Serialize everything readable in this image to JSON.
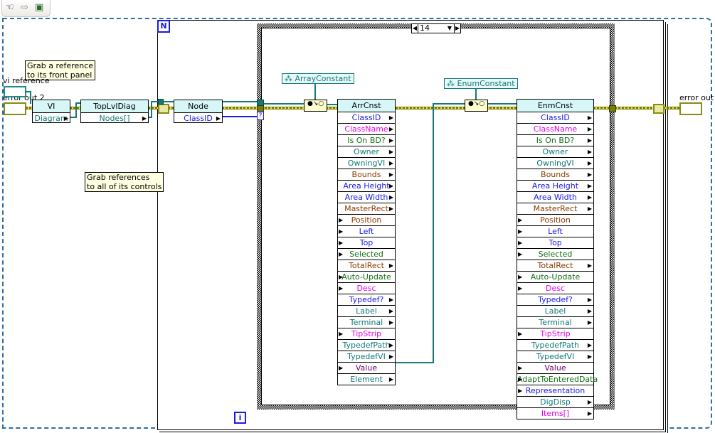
{
  "toolbar": {
    "icons": [
      "hand-operate-icon",
      "run-arrow-icon",
      "highlight-execution-icon"
    ],
    "hand_glyph": "☜",
    "arrow_glyph": "⇨",
    "highlight_glyph": "▣"
  },
  "labels": {
    "vi_reference": "vi reference",
    "error_out_2": "error out 2",
    "error_out": "error out"
  },
  "notes": {
    "front_panel": "Grab a reference\nto its front panel",
    "front_panel_l1": "Grab a reference",
    "front_panel_l2": "to its front panel",
    "controls_l1": "Grab references",
    "controls_l2": "to all of its controls"
  },
  "loop": {
    "count_terminal": "N",
    "iteration_terminal": "i"
  },
  "case": {
    "selector_value": "14",
    "left_arrow": "◀",
    "right_arrow": "▶",
    "dropdown": "▼"
  },
  "nodes": {
    "vi": {
      "title": "VI",
      "property": "Diagram"
    },
    "toplvldiag": {
      "title": "TopLvlDiag",
      "property": "Nodes[]"
    },
    "node": {
      "title": "Node",
      "property": "ClassID"
    },
    "class_id_terminal": "?",
    "arr_const": "ArrayConstant",
    "enum_const": "EnumConstant",
    "arrcnst": {
      "title": "ArrCnst",
      "properties": [
        {
          "label": "ClassID",
          "color": "blue",
          "dir": "out"
        },
        {
          "label": "ClassName",
          "color": "mag",
          "dir": "out"
        },
        {
          "label": "Is On BD?",
          "color": "green",
          "dir": "out"
        },
        {
          "label": "Owner",
          "color": "teal",
          "dir": "out"
        },
        {
          "label": "OwningVI",
          "color": "teal",
          "dir": "out"
        },
        {
          "label": "Bounds",
          "color": "brown",
          "dir": "out"
        },
        {
          "label": "Area Height",
          "color": "blue",
          "dir": "out"
        },
        {
          "label": "Area Width",
          "color": "blue",
          "dir": "out"
        },
        {
          "label": "MasterRect",
          "color": "brown",
          "dir": "out"
        },
        {
          "label": "Position",
          "color": "brown",
          "dir": "in"
        },
        {
          "label": "Left",
          "color": "blue",
          "dir": "in"
        },
        {
          "label": "Top",
          "color": "blue",
          "dir": "in"
        },
        {
          "label": "Selected",
          "color": "green",
          "dir": "in"
        },
        {
          "label": "TotalRect",
          "color": "brown",
          "dir": "out"
        },
        {
          "label": "Auto-Update",
          "color": "green",
          "dir": "in"
        },
        {
          "label": "Desc",
          "color": "mag",
          "dir": "in"
        },
        {
          "label": "Typedef?",
          "color": "blue",
          "dir": "out"
        },
        {
          "label": "Label",
          "color": "teal",
          "dir": "out"
        },
        {
          "label": "Terminal",
          "color": "teal",
          "dir": "out"
        },
        {
          "label": "TipStrip",
          "color": "mag",
          "dir": "in"
        },
        {
          "label": "TypedefPath",
          "color": "teal",
          "dir": "out"
        },
        {
          "label": "TypedefVI",
          "color": "teal",
          "dir": "out"
        },
        {
          "label": "Value",
          "color": "purple",
          "dir": "in"
        },
        {
          "label": "Element",
          "color": "teal",
          "dir": "out"
        }
      ]
    },
    "enmcnst": {
      "title": "EnmCnst",
      "properties": [
        {
          "label": "ClassID",
          "color": "blue",
          "dir": "out"
        },
        {
          "label": "ClassName",
          "color": "mag",
          "dir": "out"
        },
        {
          "label": "Is On BD?",
          "color": "green",
          "dir": "out"
        },
        {
          "label": "Owner",
          "color": "teal",
          "dir": "out"
        },
        {
          "label": "OwningVI",
          "color": "teal",
          "dir": "out"
        },
        {
          "label": "Bounds",
          "color": "brown",
          "dir": "out"
        },
        {
          "label": "Area Height",
          "color": "blue",
          "dir": "out"
        },
        {
          "label": "Area Width",
          "color": "blue",
          "dir": "out"
        },
        {
          "label": "MasterRect",
          "color": "brown",
          "dir": "out"
        },
        {
          "label": "Position",
          "color": "brown",
          "dir": "in"
        },
        {
          "label": "Left",
          "color": "blue",
          "dir": "in"
        },
        {
          "label": "Top",
          "color": "blue",
          "dir": "in"
        },
        {
          "label": "Selected",
          "color": "green",
          "dir": "in"
        },
        {
          "label": "TotalRect",
          "color": "brown",
          "dir": "out"
        },
        {
          "label": "Auto-Update",
          "color": "green",
          "dir": "in"
        },
        {
          "label": "Desc",
          "color": "mag",
          "dir": "in"
        },
        {
          "label": "Typedef?",
          "color": "blue",
          "dir": "out"
        },
        {
          "label": "Label",
          "color": "teal",
          "dir": "out"
        },
        {
          "label": "Terminal",
          "color": "teal",
          "dir": "out"
        },
        {
          "label": "TipStrip",
          "color": "mag",
          "dir": "in"
        },
        {
          "label": "TypedefPath",
          "color": "teal",
          "dir": "out"
        },
        {
          "label": "TypedefVI",
          "color": "teal",
          "dir": "out"
        },
        {
          "label": "Value",
          "color": "purple",
          "dir": "in"
        },
        {
          "label": "AdaptToEnteredData",
          "color": "green",
          "dir": "in"
        },
        {
          "label": "Representation",
          "color": "blue",
          "dir": "in"
        },
        {
          "label": "DigDisp",
          "color": "teal",
          "dir": "out"
        },
        {
          "label": "Items[]",
          "color": "mag",
          "dir": "out"
        }
      ]
    }
  },
  "colors": {
    "frame_dash": "#2b6fa3",
    "ref_wire": "#167878",
    "error_wire": "#7a7a14",
    "int_wire": "#1a1ae6",
    "node_header": "#d7f7f7",
    "note_bg": "#ffffe1"
  }
}
